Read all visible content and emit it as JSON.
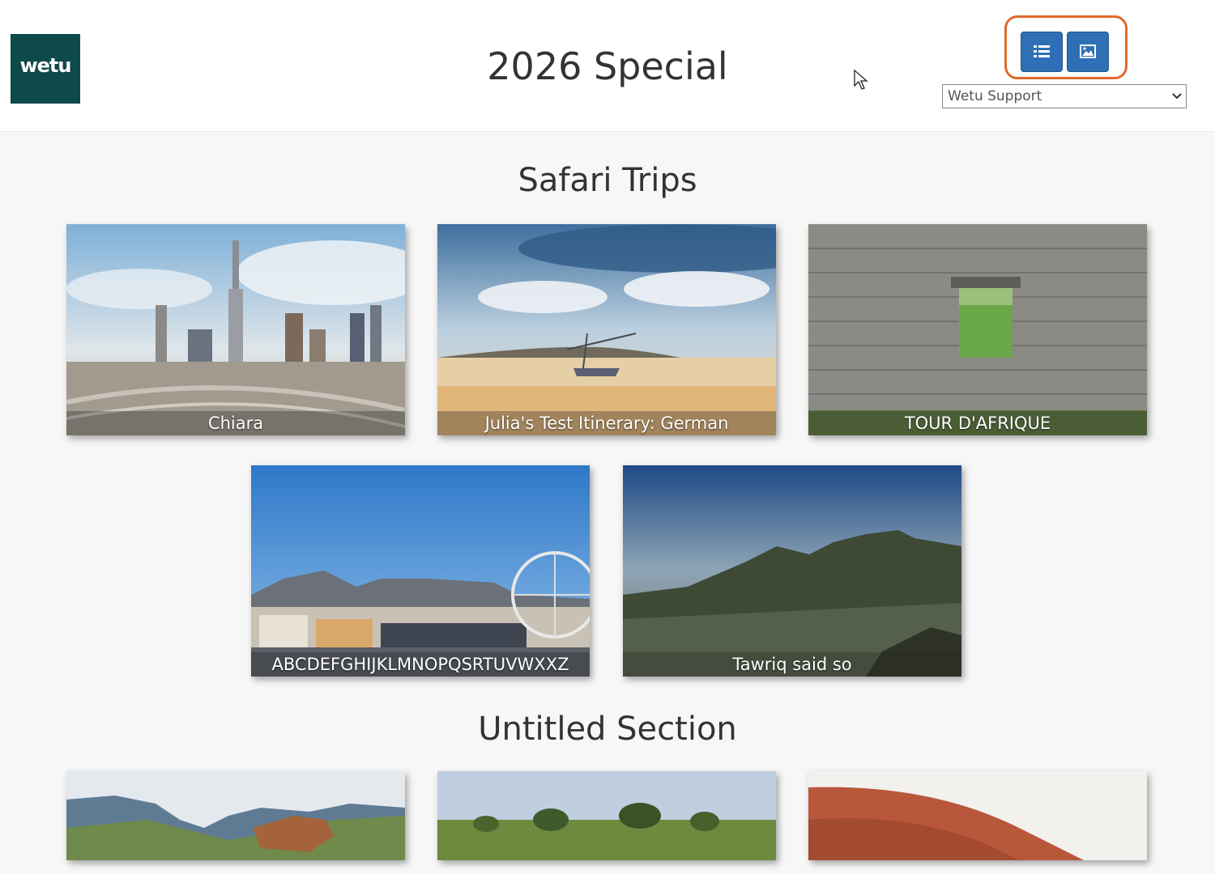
{
  "header": {
    "logo_text": "wetu",
    "title": "2026 Special",
    "account_select": {
      "value": "Wetu Support"
    },
    "view_toggle": {
      "list_icon": "list-icon",
      "grid_icon": "image-icon",
      "highlight_color": "#e06a2a"
    }
  },
  "sections": [
    {
      "title": "Safari Trips",
      "cards": [
        {
          "label": "Chiara",
          "scene": "city-skyline"
        },
        {
          "label": "Julia's Test Itinerary: German",
          "scene": "beach-boat"
        },
        {
          "label": "TOUR D'AFRIQUE",
          "scene": "stone-ruins"
        },
        {
          "label": "ABCDEFGHIJKLMNOPQSRTUVWXXZ",
          "scene": "harbour-ferris-wheel"
        },
        {
          "label": "Tawriq said so",
          "scene": "mountain-view"
        }
      ]
    },
    {
      "title": "Untitled Section",
      "cards": [
        {
          "label": "",
          "scene": "canyon"
        },
        {
          "label": "",
          "scene": "savanna"
        },
        {
          "label": "",
          "scene": "red-hill"
        }
      ]
    }
  ],
  "colors": {
    "accent": "#2f6fb5",
    "brand": "#0f4a4a",
    "highlight": "#e06a2a"
  }
}
